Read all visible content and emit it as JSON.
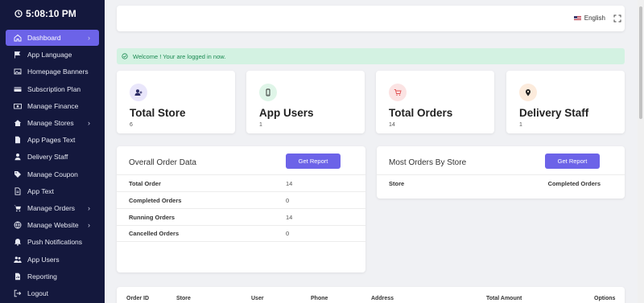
{
  "clock": "5:08:10 PM",
  "sidebar": {
    "items": [
      {
        "label": "Dashboard",
        "icon": "home-icon",
        "chevron": true,
        "active": true
      },
      {
        "label": "App Language",
        "icon": "flag-icon",
        "chevron": false
      },
      {
        "label": "Homepage Banners",
        "icon": "image-icon",
        "chevron": false
      },
      {
        "label": "Subscription Plan",
        "icon": "credit-card-icon",
        "chevron": false
      },
      {
        "label": "Manage Finance",
        "icon": "money-icon",
        "chevron": false
      },
      {
        "label": "Manage Stores",
        "icon": "store-icon",
        "chevron": true
      },
      {
        "label": "App Pages Text",
        "icon": "file-icon",
        "chevron": false
      },
      {
        "label": "Delivery Staff",
        "icon": "user-icon",
        "chevron": false
      },
      {
        "label": "Manage Coupon",
        "icon": "tag-icon",
        "chevron": false
      },
      {
        "label": "App Text",
        "icon": "text-file-icon",
        "chevron": false
      },
      {
        "label": "Manage Orders",
        "icon": "cart-icon",
        "chevron": true
      },
      {
        "label": "Manage Website",
        "icon": "globe-icon",
        "chevron": true
      },
      {
        "label": "Push Notifications",
        "icon": "bell-icon",
        "chevron": false
      },
      {
        "label": "App Users",
        "icon": "users-icon",
        "chevron": false
      },
      {
        "label": "Reporting",
        "icon": "report-icon",
        "chevron": false
      },
      {
        "label": "Logout",
        "icon": "logout-icon",
        "chevron": false
      }
    ]
  },
  "topbar": {
    "language": "English",
    "fullscreen_icon": "expand-icon"
  },
  "alert": {
    "text": "Welcome ! Your are logged in now.",
    "icon": "check-circle-icon"
  },
  "stats": [
    {
      "title": "Total Store",
      "value": "6",
      "icon": "user-plus-icon",
      "color": "#e9e6fb"
    },
    {
      "title": "App Users",
      "value": "1",
      "icon": "phone-icon",
      "color": "#dff5e8"
    },
    {
      "title": "Total Orders",
      "value": "14",
      "icon": "cart-icon",
      "color": "#fbe3e3"
    },
    {
      "title": "Delivery Staff",
      "value": "1",
      "icon": "location-pin-icon",
      "color": "#fcebdc"
    }
  ],
  "overall": {
    "title": "Overall Order Data",
    "button": "Get Report",
    "rows": [
      {
        "label": "Total Order",
        "value": "14"
      },
      {
        "label": "Completed Orders",
        "value": "0"
      },
      {
        "label": "Running Orders",
        "value": "14"
      },
      {
        "label": "Cancelled Orders",
        "value": "0"
      }
    ]
  },
  "most": {
    "title": "Most Orders By Store",
    "button": "Get Report",
    "col1": "Store",
    "col2": "Completed Orders"
  },
  "orders_table": {
    "headers": [
      "Order ID",
      "Store",
      "User",
      "Phone",
      "Address",
      "Total Amount",
      "Options"
    ]
  },
  "colors": {
    "accent": "#6c63e8",
    "sidebar": "#14183d",
    "success_bg": "#d3f2e2"
  }
}
